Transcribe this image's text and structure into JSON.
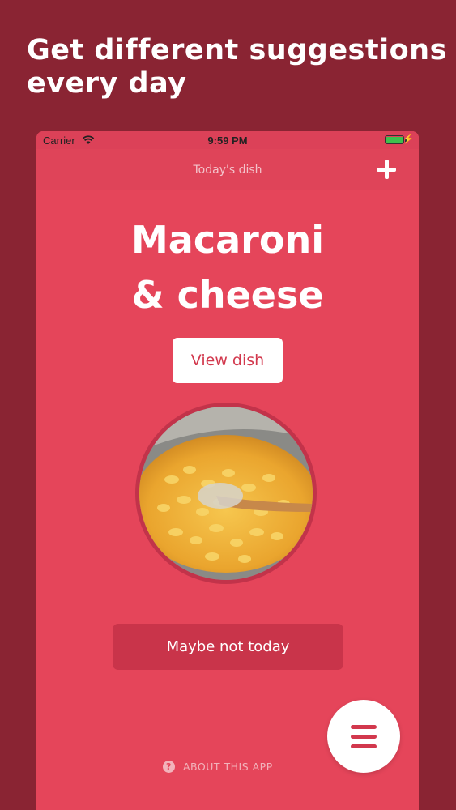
{
  "headline": {
    "line1": "Get different suggestions",
    "line2": "every day"
  },
  "status_bar": {
    "carrier": "Carrier",
    "time": "9:59 PM",
    "battery_color": "#3ec14d"
  },
  "nav": {
    "title": "Today's dish",
    "add_icon": "plus-icon"
  },
  "dish": {
    "name_line1": "Macaroni",
    "name_line2": "& cheese",
    "view_button": "View dish",
    "photo": "macaroni-and-cheese-photo"
  },
  "actions": {
    "maybe_button": "Maybe not today",
    "about_label": "ABOUT THIS APP",
    "about_icon": "question-icon",
    "menu_icon": "hamburger-menu-icon"
  },
  "colors": {
    "background": "#8a2433",
    "screen": "#e5455a",
    "accent": "#d2384d"
  }
}
